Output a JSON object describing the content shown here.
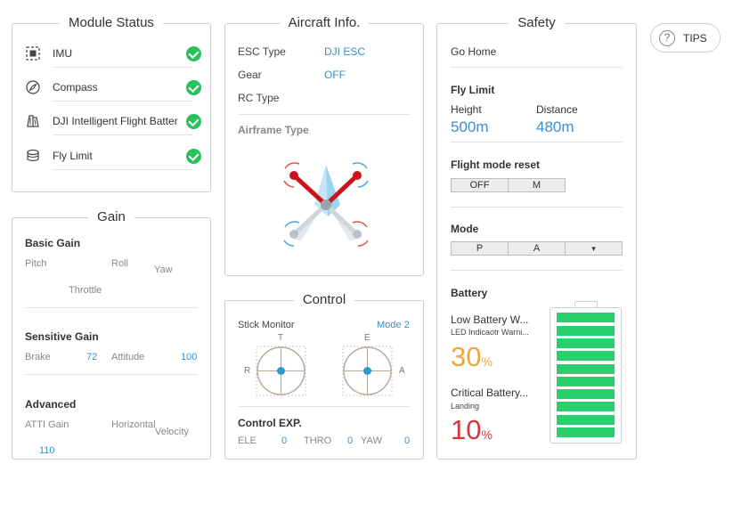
{
  "module_status": {
    "title": "Module Status",
    "items": [
      {
        "label": "IMU",
        "icon": "imu-icon",
        "ok": true
      },
      {
        "label": "Compass",
        "icon": "compass-icon",
        "ok": true
      },
      {
        "label": "DJI Intelligent Flight Batter",
        "icon": "battery-icon",
        "ok": true
      },
      {
        "label": "Fly Limit",
        "icon": "fly-limit-icon",
        "ok": true
      }
    ]
  },
  "gain": {
    "title": "Gain",
    "basic": {
      "heading": "Basic Gain",
      "pitch": "Pitch",
      "roll": "Roll",
      "yaw": "Yaw",
      "throttle": "Throttle"
    },
    "sensitive": {
      "heading": "Sensitive Gain",
      "brake_label": "Brake",
      "brake_value": "72",
      "attitude_label": "Attitude",
      "attitude_value": "100"
    },
    "advanced": {
      "heading": "Advanced",
      "atti_label": "ATTI Gain",
      "atti_value": "110",
      "horizontal": "Horizontal",
      "velocity": "Velocity"
    }
  },
  "aircraft": {
    "title": "Aircraft Info.",
    "esc_label": "ESC Type",
    "esc_value": "DJI ESC",
    "gear_label": "Gear",
    "gear_value": "OFF",
    "rc_label": "RC Type",
    "airframe_label": "Airframe Type"
  },
  "control": {
    "title": "Control",
    "stick_monitor": "Stick Monitor",
    "mode": "Mode 2",
    "left_stick": {
      "top": "T",
      "left": "R"
    },
    "right_stick": {
      "top": "E",
      "right": "A"
    },
    "exp_heading": "Control EXP.",
    "exp": [
      {
        "label": "ELE",
        "value": "0"
      },
      {
        "label": "THRO",
        "value": "0"
      },
      {
        "label": "YAW",
        "value": "0"
      }
    ]
  },
  "safety": {
    "title": "Safety",
    "go_home": "Go Home",
    "fly_limit": {
      "heading": "Fly Limit",
      "height_label": "Height",
      "height_value": "500m",
      "distance_label": "Distance",
      "distance_value": "480m"
    },
    "flight_mode_reset": {
      "heading": "Flight mode reset",
      "options": [
        "OFF",
        "M"
      ]
    },
    "mode": {
      "heading": "Mode",
      "options": [
        "P",
        "A",
        "▾"
      ]
    },
    "battery": {
      "heading": "Battery",
      "low_title": "Low Battery W...",
      "low_sub": "LED Indicaotr Warni...",
      "low_value": "30",
      "critical_title": "Critical Battery...",
      "critical_sub": "Landing",
      "critical_value": "10",
      "unit": "%",
      "level_cells": 10
    }
  },
  "tips": {
    "label": "TIPS",
    "icon": "help-icon"
  },
  "colors": {
    "accent": "#3a8fc8",
    "ok": "#27c15e",
    "low": "#f0a63a",
    "critical": "#d8343e",
    "cell": "#27d06a"
  }
}
